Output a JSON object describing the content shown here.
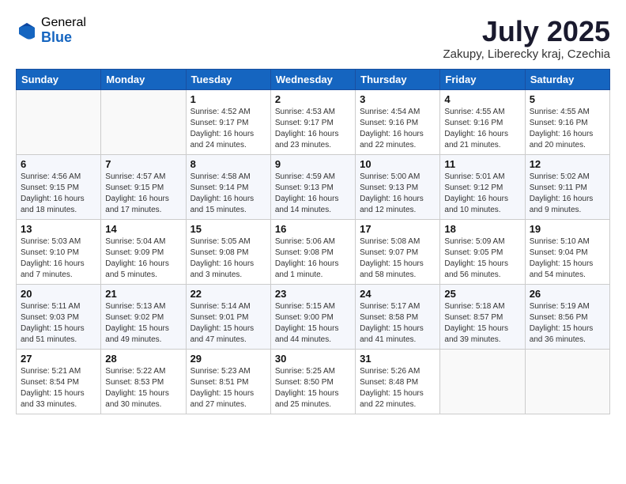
{
  "logo": {
    "general": "General",
    "blue": "Blue"
  },
  "title": {
    "month_year": "July 2025",
    "location": "Zakupy, Liberecky kraj, Czechia"
  },
  "headers": [
    "Sunday",
    "Monday",
    "Tuesday",
    "Wednesday",
    "Thursday",
    "Friday",
    "Saturday"
  ],
  "weeks": [
    [
      {
        "day": "",
        "detail": ""
      },
      {
        "day": "",
        "detail": ""
      },
      {
        "day": "1",
        "detail": "Sunrise: 4:52 AM\nSunset: 9:17 PM\nDaylight: 16 hours\nand 24 minutes."
      },
      {
        "day": "2",
        "detail": "Sunrise: 4:53 AM\nSunset: 9:17 PM\nDaylight: 16 hours\nand 23 minutes."
      },
      {
        "day": "3",
        "detail": "Sunrise: 4:54 AM\nSunset: 9:16 PM\nDaylight: 16 hours\nand 22 minutes."
      },
      {
        "day": "4",
        "detail": "Sunrise: 4:55 AM\nSunset: 9:16 PM\nDaylight: 16 hours\nand 21 minutes."
      },
      {
        "day": "5",
        "detail": "Sunrise: 4:55 AM\nSunset: 9:16 PM\nDaylight: 16 hours\nand 20 minutes."
      }
    ],
    [
      {
        "day": "6",
        "detail": "Sunrise: 4:56 AM\nSunset: 9:15 PM\nDaylight: 16 hours\nand 18 minutes."
      },
      {
        "day": "7",
        "detail": "Sunrise: 4:57 AM\nSunset: 9:15 PM\nDaylight: 16 hours\nand 17 minutes."
      },
      {
        "day": "8",
        "detail": "Sunrise: 4:58 AM\nSunset: 9:14 PM\nDaylight: 16 hours\nand 15 minutes."
      },
      {
        "day": "9",
        "detail": "Sunrise: 4:59 AM\nSunset: 9:13 PM\nDaylight: 16 hours\nand 14 minutes."
      },
      {
        "day": "10",
        "detail": "Sunrise: 5:00 AM\nSunset: 9:13 PM\nDaylight: 16 hours\nand 12 minutes."
      },
      {
        "day": "11",
        "detail": "Sunrise: 5:01 AM\nSunset: 9:12 PM\nDaylight: 16 hours\nand 10 minutes."
      },
      {
        "day": "12",
        "detail": "Sunrise: 5:02 AM\nSunset: 9:11 PM\nDaylight: 16 hours\nand 9 minutes."
      }
    ],
    [
      {
        "day": "13",
        "detail": "Sunrise: 5:03 AM\nSunset: 9:10 PM\nDaylight: 16 hours\nand 7 minutes."
      },
      {
        "day": "14",
        "detail": "Sunrise: 5:04 AM\nSunset: 9:09 PM\nDaylight: 16 hours\nand 5 minutes."
      },
      {
        "day": "15",
        "detail": "Sunrise: 5:05 AM\nSunset: 9:08 PM\nDaylight: 16 hours\nand 3 minutes."
      },
      {
        "day": "16",
        "detail": "Sunrise: 5:06 AM\nSunset: 9:08 PM\nDaylight: 16 hours\nand 1 minute."
      },
      {
        "day": "17",
        "detail": "Sunrise: 5:08 AM\nSunset: 9:07 PM\nDaylight: 15 hours\nand 58 minutes."
      },
      {
        "day": "18",
        "detail": "Sunrise: 5:09 AM\nSunset: 9:05 PM\nDaylight: 15 hours\nand 56 minutes."
      },
      {
        "day": "19",
        "detail": "Sunrise: 5:10 AM\nSunset: 9:04 PM\nDaylight: 15 hours\nand 54 minutes."
      }
    ],
    [
      {
        "day": "20",
        "detail": "Sunrise: 5:11 AM\nSunset: 9:03 PM\nDaylight: 15 hours\nand 51 minutes."
      },
      {
        "day": "21",
        "detail": "Sunrise: 5:13 AM\nSunset: 9:02 PM\nDaylight: 15 hours\nand 49 minutes."
      },
      {
        "day": "22",
        "detail": "Sunrise: 5:14 AM\nSunset: 9:01 PM\nDaylight: 15 hours\nand 47 minutes."
      },
      {
        "day": "23",
        "detail": "Sunrise: 5:15 AM\nSunset: 9:00 PM\nDaylight: 15 hours\nand 44 minutes."
      },
      {
        "day": "24",
        "detail": "Sunrise: 5:17 AM\nSunset: 8:58 PM\nDaylight: 15 hours\nand 41 minutes."
      },
      {
        "day": "25",
        "detail": "Sunrise: 5:18 AM\nSunset: 8:57 PM\nDaylight: 15 hours\nand 39 minutes."
      },
      {
        "day": "26",
        "detail": "Sunrise: 5:19 AM\nSunset: 8:56 PM\nDaylight: 15 hours\nand 36 minutes."
      }
    ],
    [
      {
        "day": "27",
        "detail": "Sunrise: 5:21 AM\nSunset: 8:54 PM\nDaylight: 15 hours\nand 33 minutes."
      },
      {
        "day": "28",
        "detail": "Sunrise: 5:22 AM\nSunset: 8:53 PM\nDaylight: 15 hours\nand 30 minutes."
      },
      {
        "day": "29",
        "detail": "Sunrise: 5:23 AM\nSunset: 8:51 PM\nDaylight: 15 hours\nand 27 minutes."
      },
      {
        "day": "30",
        "detail": "Sunrise: 5:25 AM\nSunset: 8:50 PM\nDaylight: 15 hours\nand 25 minutes."
      },
      {
        "day": "31",
        "detail": "Sunrise: 5:26 AM\nSunset: 8:48 PM\nDaylight: 15 hours\nand 22 minutes."
      },
      {
        "day": "",
        "detail": ""
      },
      {
        "day": "",
        "detail": ""
      }
    ]
  ]
}
